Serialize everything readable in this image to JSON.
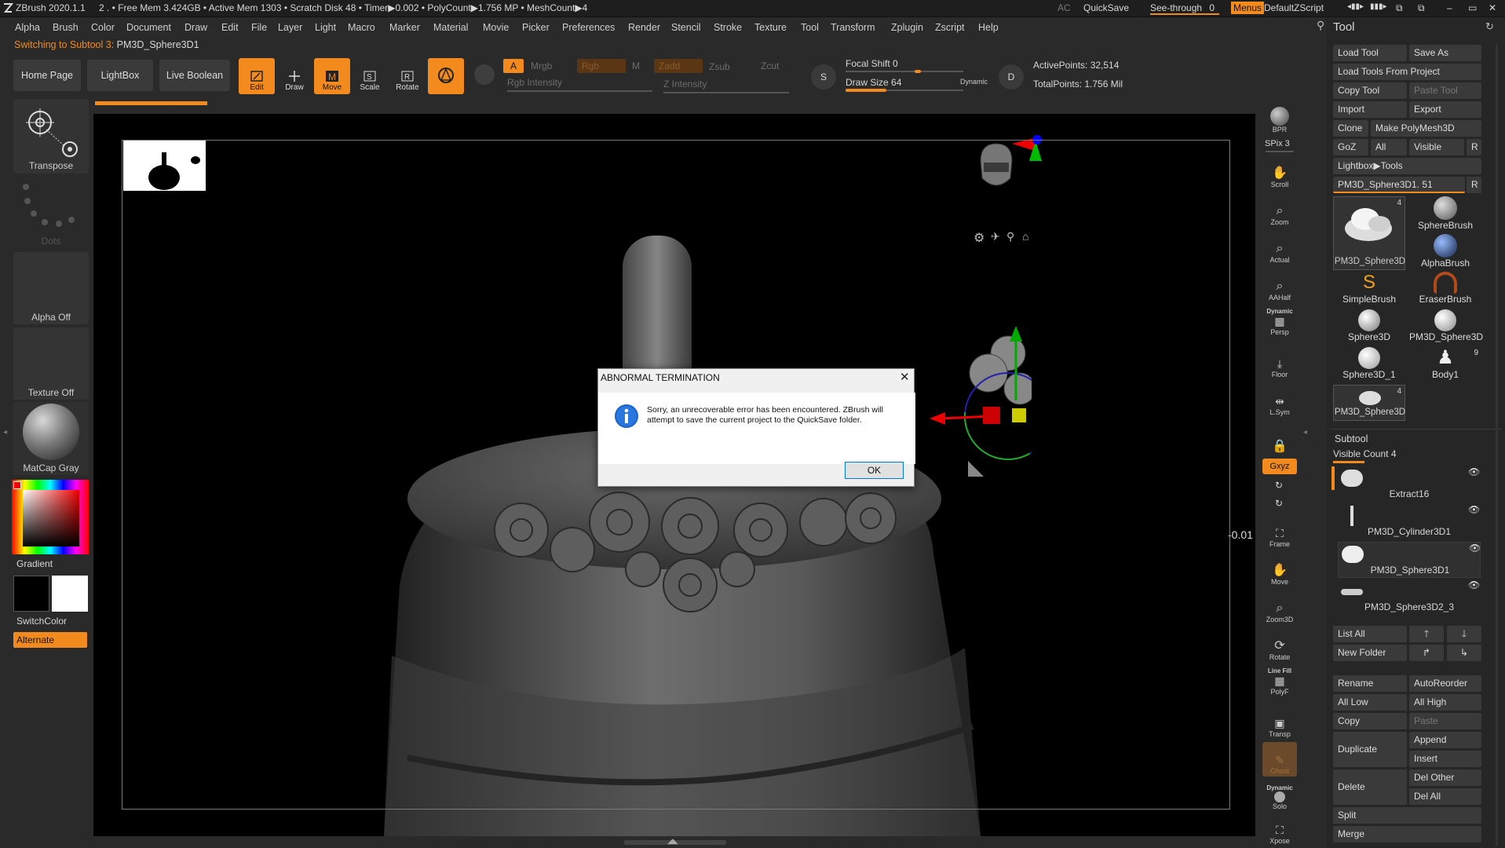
{
  "titlebar": {
    "app": "ZBrush 2020.1.1",
    "stats": "2  . • Free Mem 3.424GB • Active Mem 1303 • Scratch Disk 48 •  Timer▶0.002 • PolyCount▶1.756 MP  • MeshCount▶4",
    "ac": "AC",
    "quicksave": "QuickSave",
    "see_through_label": "See-through",
    "see_through_value": "0",
    "menus": "Menus",
    "script": "DefaultZScript"
  },
  "menubar": [
    "Alpha",
    "Brush",
    "Color",
    "Document",
    "Draw",
    "Edit",
    "File",
    "Layer",
    "Light",
    "Macro",
    "Marker",
    "Material",
    "Movie",
    "Picker",
    "Preferences",
    "Render",
    "Stencil",
    "Stroke",
    "Texture",
    "Tool",
    "Transform",
    "Zplugin",
    "Zscript",
    "Help"
  ],
  "status": {
    "prefix": "Switching to Subtool 3:",
    "subtool": "PM3D_Sphere3D1"
  },
  "toolbar": {
    "home_page": "Home Page",
    "lightbox": "LightBox",
    "live_boolean": "Live Boolean",
    "edit": "Edit",
    "draw": "Draw",
    "move": "Move",
    "scale": "Scale",
    "rotate": "Rotate",
    "a": "A",
    "mrgb": "Mrgb",
    "rgb": "Rgb",
    "m": "M",
    "zadd": "Zadd",
    "zsub": "Zsub",
    "zcut": "Zcut",
    "rgb_intensity": "Rgb Intensity",
    "z_intensity": "Z Intensity",
    "focal_shift_label": "Focal Shift",
    "focal_shift_value": "0",
    "draw_size_label": "Draw Size",
    "draw_size_value": "64",
    "dynamic": "Dynamic",
    "active_points": "ActivePoints: 32,514",
    "total_points": "TotalPoints: 1.756 Mil"
  },
  "leftpanel": {
    "transpose": "Transpose",
    "dots": "Dots",
    "alpha_off": "Alpha Off",
    "texture_off": "Texture Off",
    "matcap": "MatCap Gray",
    "gradient": "Gradient",
    "switchcolor": "SwitchColor",
    "alternate": "Alternate"
  },
  "viewport": {
    "coord_readout": "-0.01"
  },
  "shelf": {
    "bpr": "BPR",
    "spix": "SPix 3",
    "scroll": "Scroll",
    "zoom": "Zoom",
    "actual": "Actual",
    "aahalf": "AAHalf",
    "dynamic": "Dynamic",
    "persp": "Persp",
    "floor": "Floor",
    "lsym": "L.Sym",
    "xyz": "Gxyz",
    "frame": "Frame",
    "move": "Move",
    "zoom3d": "Zoom3D",
    "rotate": "Rotate",
    "linefill": "Line Fill",
    "polyf": "PolyF",
    "transp": "Transp",
    "ghost": "Ghost",
    "solo_dynamic": "Dynamic",
    "solo": "Solo",
    "xpose": "Xpose"
  },
  "toolpanel": {
    "title": "Tool",
    "load_tool": "Load Tool",
    "save_as": "Save As",
    "load_from_project": "Load Tools From Project",
    "copy_tool": "Copy Tool",
    "paste_tool": "Paste Tool",
    "import": "Import",
    "export": "Export",
    "clone": "Clone",
    "make_polymesh": "Make PolyMesh3D",
    "goz": "GoZ",
    "all": "All",
    "visible": "Visible",
    "r": "R",
    "lightbox_tools": "Lightbox▶Tools",
    "current_tool": "PM3D_Sphere3D1. 51",
    "thumbs": [
      {
        "label": "PM3D_Sphere3D",
        "badge": "4"
      },
      {
        "label": "SphereBrush",
        "badge": ""
      },
      {
        "label": "AlphaBrush",
        "badge": ""
      },
      {
        "label": "SimpleBrush",
        "badge": ""
      },
      {
        "label": "EraserBrush",
        "badge": ""
      },
      {
        "label": "Sphere3D",
        "badge": ""
      },
      {
        "label": "PM3D_Sphere3D",
        "badge": ""
      },
      {
        "label": "Sphere3D_1",
        "badge": ""
      },
      {
        "label": "Body1",
        "badge": "9"
      },
      {
        "label": "PM3D_Sphere3D",
        "badge": "4"
      }
    ],
    "subtool_title": "Subtool",
    "visible_count": "Visible Count 4",
    "subtools": [
      "Extract16",
      "PM3D_Cylinder3D1",
      "PM3D_Sphere3D1",
      "PM3D_Sphere3D2_3"
    ],
    "list_all": "List All",
    "new_folder": "New Folder",
    "rename": "Rename",
    "autoreorder": "AutoReorder",
    "all_low": "All Low",
    "all_high": "All High",
    "copy": "Copy",
    "paste": "Paste",
    "duplicate": "Duplicate",
    "append": "Append",
    "insert": "Insert",
    "delete": "Delete",
    "del_other": "Del Other",
    "del_all": "Del All",
    "split": "Split",
    "merge": "Merge"
  },
  "dialog": {
    "title": "ABNORMAL TERMINATION",
    "message": "Sorry, an unrecoverable error has been encountered. ZBrush will attempt to save the current project to the QuickSave folder.",
    "ok": "OK"
  }
}
